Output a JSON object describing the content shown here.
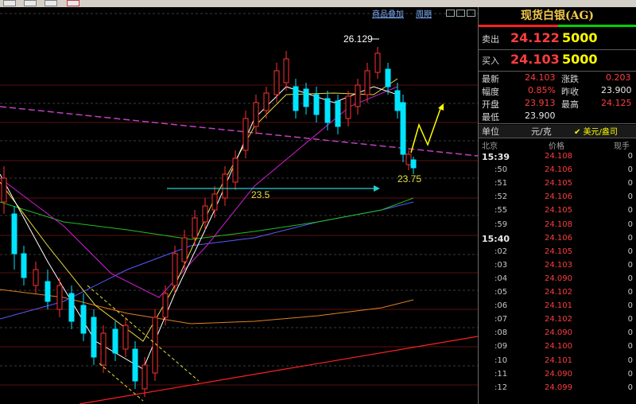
{
  "panel": {
    "title": "现货白银(AG)",
    "sell": {
      "label": "卖出",
      "price": "24.122",
      "qty": "5000"
    },
    "buy": {
      "label": "买入",
      "price": "24.103",
      "qty": "5000"
    },
    "stats": [
      {
        "label": "最新",
        "value": "24.103",
        "label2": "涨跌",
        "value2": "0.203"
      },
      {
        "label": "幅度",
        "value": "0.85%",
        "label2": "昨收",
        "value2": "23.900"
      },
      {
        "label": "开盘",
        "value": "23.913",
        "label2": "最高",
        "value2": "24.125"
      },
      {
        "label": "最低",
        "value": "23.900",
        "label2": "",
        "value2": ""
      }
    ],
    "unit_label": "单位",
    "unit_value": "元/克",
    "currency_toggle": "美元/盎司",
    "ticks_header": {
      "place": "北京",
      "price": "价格",
      "volume": "现手"
    },
    "ticks": [
      {
        "time": "15:39",
        "price": "24.108",
        "volume": "0",
        "major": true
      },
      {
        "time": ":50",
        "price": "24.106",
        "volume": "0"
      },
      {
        "time": ":51",
        "price": "24.105",
        "volume": "0"
      },
      {
        "time": ":52",
        "price": "24.106",
        "volume": "0"
      },
      {
        "time": ":55",
        "price": "24.105",
        "volume": "0"
      },
      {
        "time": ":59",
        "price": "24.108",
        "volume": "0"
      },
      {
        "time": "15:40",
        "price": "24.106",
        "volume": "0",
        "major": true
      },
      {
        "time": ":02",
        "price": "24.105",
        "volume": "0"
      },
      {
        "time": ":03",
        "price": "24.103",
        "volume": "0"
      },
      {
        "time": ":04",
        "price": "24.090",
        "volume": "0"
      },
      {
        "time": ":05",
        "price": "24.102",
        "volume": "0"
      },
      {
        "time": ":06",
        "price": "24.101",
        "volume": "0"
      },
      {
        "time": ":07",
        "price": "24.102",
        "volume": "0"
      },
      {
        "time": ":08",
        "price": "24.090",
        "volume": "0"
      },
      {
        "time": ":09",
        "price": "24.100",
        "volume": "0"
      },
      {
        "time": ":10",
        "price": "24.101",
        "volume": "0"
      },
      {
        "time": ":11",
        "price": "24.090",
        "volume": "0"
      },
      {
        "time": ":12",
        "price": "24.099",
        "volume": "0"
      }
    ]
  },
  "chart": {
    "overlay_link": "商品叠加",
    "period_link": "周期",
    "annotations": {
      "high": "26.129",
      "level1": "23.5",
      "level2": "23.75"
    },
    "colors": {
      "up": "#ff3030",
      "down": "#00e5ff",
      "ma5": "#ffffff",
      "ma10": "#e5e040",
      "ma20": "#d020d0",
      "ma40": "#20c020",
      "ma60": "#5a5aff",
      "ma120": "#e08020",
      "trend": "#ff2020",
      "channel": "#c040c0"
    }
  }
}
